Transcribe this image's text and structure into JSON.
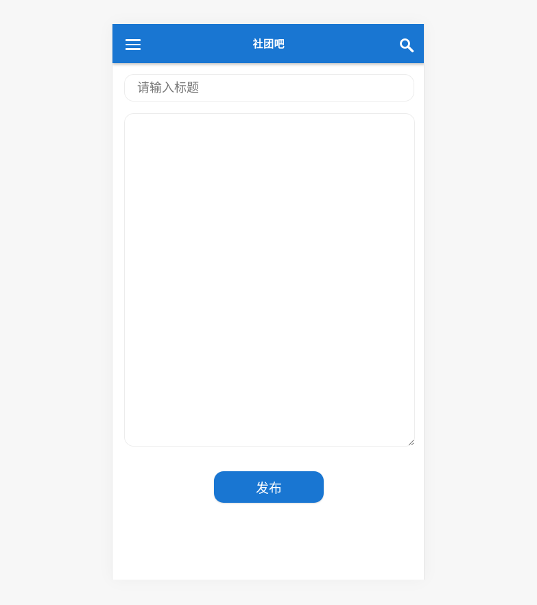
{
  "appbar": {
    "title": "社团吧",
    "menu_icon": "menu-icon",
    "search_icon": "search-icon",
    "color": "#1976d2"
  },
  "form": {
    "title_placeholder": "请输入标题",
    "title_value": "",
    "content_value": "",
    "publish_label": "发布"
  }
}
